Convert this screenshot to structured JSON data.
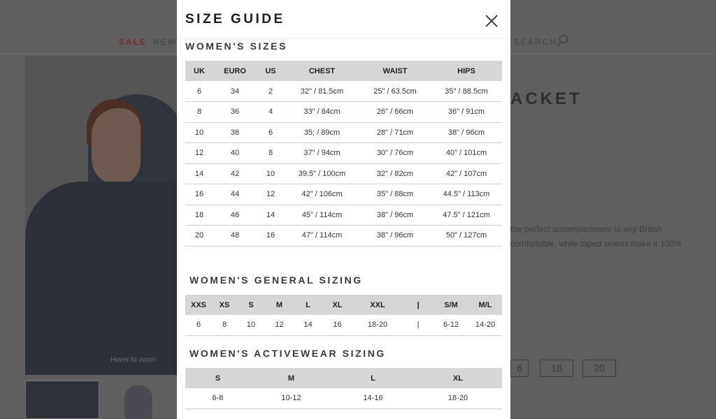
{
  "background": {
    "nav": {
      "sale": "SALE",
      "new": "NEW",
      "search": "SEARCH"
    },
    "zoom_hint": "Hover to zoom",
    "product_title": "ACKET",
    "description_lines": [
      "the perfect accompaniment to any British",
      "comfortable, while taped seams make it 100%"
    ],
    "size_buttons": [
      "6",
      "18",
      "20"
    ]
  },
  "modal": {
    "title": "SIZE GUIDE",
    "sections": {
      "womens_sizes": {
        "title": "WOMEN'S SIZES",
        "headers": [
          "UK",
          "EURO",
          "US",
          "CHEST",
          "WAIST",
          "HIPS"
        ],
        "rows": [
          [
            "6",
            "34",
            "2",
            "32\" / 81.5cm",
            "25\" / 63.5cm",
            "35\" / 88.5cm"
          ],
          [
            "8",
            "36",
            "4",
            "33\" / 84cm",
            "26\" / 66cm",
            "36\" / 91cm"
          ],
          [
            "10",
            "38",
            "6",
            "35; / 89cm",
            "28\" / 71cm",
            "38\" / 96cm"
          ],
          [
            "12",
            "40",
            "8",
            "37\" / 94cm",
            "30\" / 76cm",
            "40\" / 101cm"
          ],
          [
            "14",
            "42",
            "10",
            "39.5\" / 100cm",
            "32\" / 82cm",
            "42\" / 107cm"
          ],
          [
            "16",
            "44",
            "12",
            "42\" / 106cm",
            "35\" / 88cm",
            "44.5\" / 113cm"
          ],
          [
            "18",
            "46",
            "14",
            "45\" / 114cm",
            "38\" / 96cm",
            "47.5\" / 121cm"
          ],
          [
            "20",
            "48",
            "16",
            "47\" / 114cm",
            "38\" / 96cm",
            "50\" / 127cm"
          ]
        ]
      },
      "womens_general": {
        "title": "WOMEN'S GENERAL SIZING",
        "headers": [
          "XXS",
          "XS",
          "S",
          "M",
          "L",
          "XL",
          "XXL",
          "|",
          "S/M",
          "M/L"
        ],
        "rows": [
          [
            "6",
            "8",
            "10",
            "12",
            "14",
            "16",
            "18-20",
            "|",
            "6-12",
            "14-20"
          ]
        ]
      },
      "womens_activewear": {
        "title": "WOMEN'S ACTIVEWEAR SIZING",
        "headers": [
          "S",
          "M",
          "L",
          "XL"
        ],
        "rows": [
          [
            "6-8",
            "10-12",
            "14-16",
            "18-20"
          ]
        ]
      }
    }
  }
}
